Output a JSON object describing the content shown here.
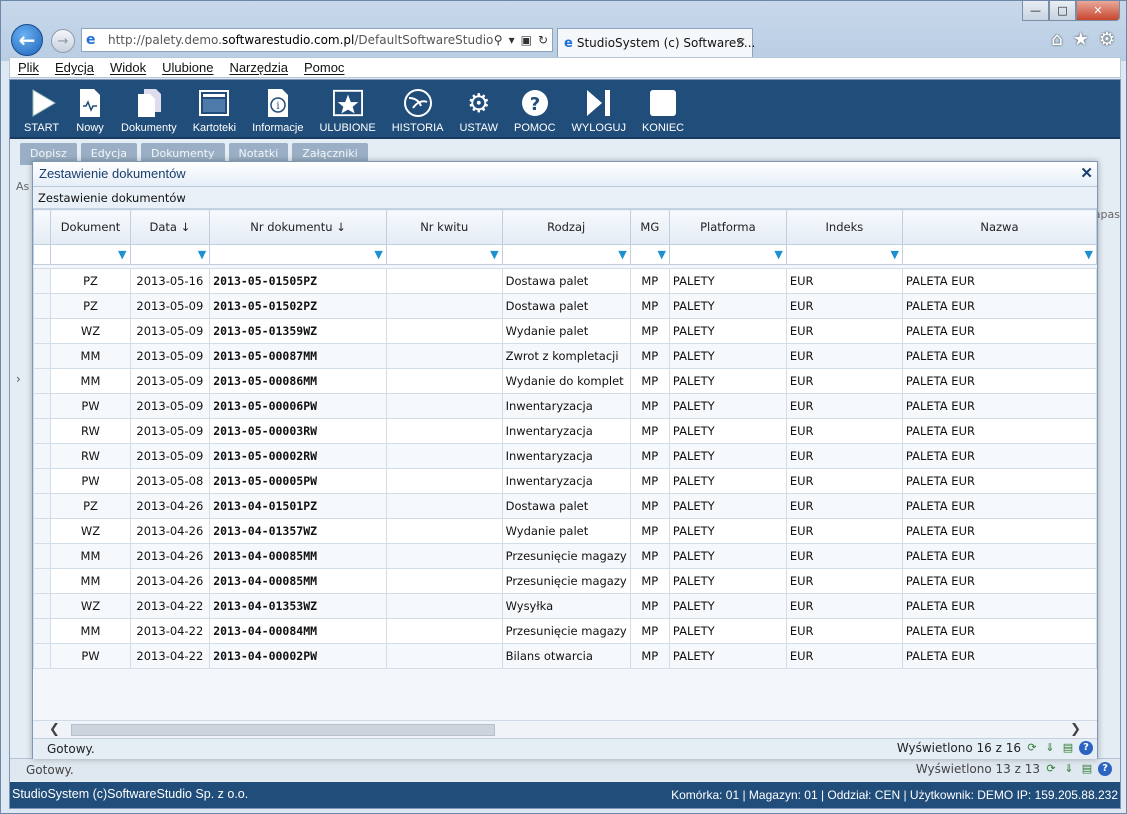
{
  "browser": {
    "url_prefix": "http://palety.demo.",
    "url_domain": "softwarestudio.com.pl",
    "url_suffix": "/DefaultSoftwareStudio.aspx?",
    "tab_title": "StudioSystem (c) SoftwareS..."
  },
  "menu": [
    "Plik",
    "Edycja",
    "Widok",
    "Ulubione",
    "Narzędzia",
    "Pomoc"
  ],
  "toolbar": [
    {
      "label": "START",
      "icon": "play-icon"
    },
    {
      "label": "Nowy",
      "icon": "new-document-icon"
    },
    {
      "label": "Dokumenty",
      "icon": "documents-icon"
    },
    {
      "label": "Kartoteki",
      "icon": "card-index-icon"
    },
    {
      "label": "Informacje",
      "icon": "info-icon"
    },
    {
      "label": "ULUBIONE",
      "icon": "favorites-star-icon"
    },
    {
      "label": "HISTORIA",
      "icon": "history-icon"
    },
    {
      "label": "USTAW",
      "icon": "settings-gears-icon"
    },
    {
      "label": "POMOC",
      "icon": "help-icon"
    },
    {
      "label": "WYLOGUJ",
      "icon": "logout-icon"
    },
    {
      "label": "KONIEC",
      "icon": "exit-icon"
    }
  ],
  "subtools": [
    "Dopisz",
    "Edycja",
    "Dokumenty",
    "Notatki",
    "Załączniki"
  ],
  "background": {
    "left_label": "As",
    "right_label": "apas"
  },
  "dialog": {
    "title": "Zestawienie dokumentów",
    "subtitle": "Zestawienie dokumentów",
    "columns": [
      "Dokument",
      "Data ↓",
      "Nr dokumentu ↓",
      "Nr kwitu",
      "Rodzaj",
      "MG",
      "Platforma",
      "Indeks",
      "Nazwa"
    ],
    "rows": [
      [
        "PZ",
        "2013-05-16",
        "2013-05-01505PZ",
        "",
        "Dostawa palet",
        "MP",
        "PALETY",
        "EUR",
        "PALETA EUR"
      ],
      [
        "PZ",
        "2013-05-09",
        "2013-05-01502PZ",
        "",
        "Dostawa palet",
        "MP",
        "PALETY",
        "EUR",
        "PALETA EUR"
      ],
      [
        "WZ",
        "2013-05-09",
        "2013-05-01359WZ",
        "",
        "Wydanie palet",
        "MP",
        "PALETY",
        "EUR",
        "PALETA EUR"
      ],
      [
        "MM",
        "2013-05-09",
        "2013-05-00087MM",
        "",
        "Zwrot z kompletacji",
        "MP",
        "PALETY",
        "EUR",
        "PALETA EUR"
      ],
      [
        "MM",
        "2013-05-09",
        "2013-05-00086MM",
        "",
        "Wydanie do komplet",
        "MP",
        "PALETY",
        "EUR",
        "PALETA EUR"
      ],
      [
        "PW",
        "2013-05-09",
        "2013-05-00006PW",
        "",
        "Inwentaryzacja",
        "MP",
        "PALETY",
        "EUR",
        "PALETA EUR"
      ],
      [
        "RW",
        "2013-05-09",
        "2013-05-00003RW",
        "",
        "Inwentaryzacja",
        "MP",
        "PALETY",
        "EUR",
        "PALETA EUR"
      ],
      [
        "RW",
        "2013-05-09",
        "2013-05-00002RW",
        "",
        "Inwentaryzacja",
        "MP",
        "PALETY",
        "EUR",
        "PALETA EUR"
      ],
      [
        "PW",
        "2013-05-08",
        "2013-05-00005PW",
        "",
        "Inwentaryzacja",
        "MP",
        "PALETY",
        "EUR",
        "PALETA EUR"
      ],
      [
        "PZ",
        "2013-04-26",
        "2013-04-01501PZ",
        "",
        "Dostawa palet",
        "MP",
        "PALETY",
        "EUR",
        "PALETA EUR"
      ],
      [
        "WZ",
        "2013-04-26",
        "2013-04-01357WZ",
        "",
        "Wydanie palet",
        "MP",
        "PALETY",
        "EUR",
        "PALETA EUR"
      ],
      [
        "MM",
        "2013-04-26",
        "2013-04-00085MM",
        "",
        "Przesunięcie magazy",
        "MP",
        "PALETY",
        "EUR",
        "PALETA EUR"
      ],
      [
        "MM",
        "2013-04-26",
        "2013-04-00085MM",
        "",
        "Przesunięcie magazy",
        "MP",
        "PALETY",
        "EUR",
        "PALETA EUR"
      ],
      [
        "WZ",
        "2013-04-22",
        "2013-04-01353WZ",
        "",
        "Wysyłka",
        "MP",
        "PALETY",
        "EUR",
        "PALETA EUR"
      ],
      [
        "MM",
        "2013-04-22",
        "2013-04-00084MM",
        "",
        "Przesunięcie magazy",
        "MP",
        "PALETY",
        "EUR",
        "PALETA EUR"
      ],
      [
        "PW",
        "2013-04-22",
        "2013-04-00002PW",
        "",
        "Bilans otwarcia",
        "MP",
        "PALETY",
        "EUR",
        "PALETA EUR"
      ]
    ],
    "status": "Gotowy.",
    "count": "Wyświetlono 16 z 16"
  },
  "app_status": {
    "text": "Gotowy.",
    "count": "Wyświetlono 13 z 13"
  },
  "footer": {
    "left": "StudioSystem (c)SoftwareStudio Sp. z o.o.",
    "right": "Komórka: 01 | Magazyn: 01 | Oddział: CEN | Użytkownik: DEMO IP: 159.205.88.232"
  },
  "colors": {
    "accent": "#204d7a",
    "filter_icon": "#1e90d0"
  }
}
